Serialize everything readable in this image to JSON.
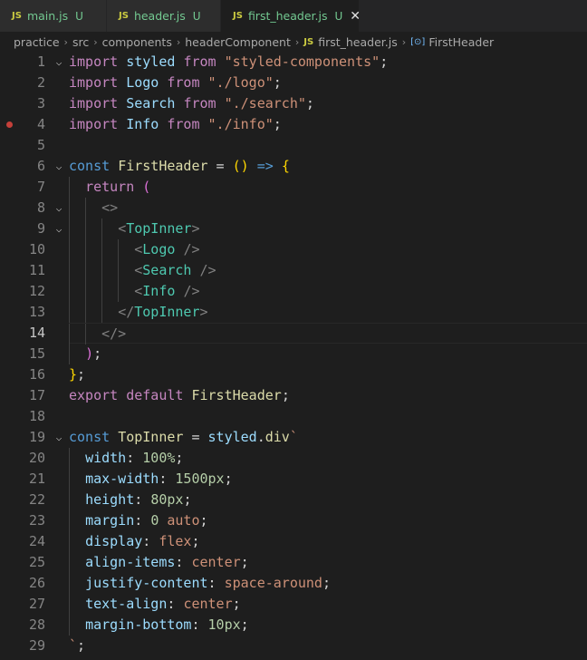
{
  "tabs": [
    {
      "icon": "JS",
      "name": "main.js",
      "status": "U"
    },
    {
      "icon": "JS",
      "name": "header.js",
      "status": "U"
    },
    {
      "icon": "JS",
      "name": "first_header.js",
      "status": "U",
      "close": "✕"
    }
  ],
  "breadcrumb": {
    "items": [
      "practice",
      "src",
      "components",
      "headerComponent"
    ],
    "file_icon": "JS",
    "file": "first_header.js",
    "symbol_icon": "[⊙]",
    "symbol": "FirstHeader",
    "separator": "›"
  },
  "editor": {
    "current_line": 14,
    "breakpoint_line": 4,
    "fold_lines": [
      1,
      6,
      8,
      9,
      19
    ],
    "lines": [
      [
        [
          "kw",
          "import"
        ],
        [
          "pun",
          " "
        ],
        [
          "id",
          "styled"
        ],
        [
          "pun",
          " "
        ],
        [
          "kw",
          "from"
        ],
        [
          "pun",
          " "
        ],
        [
          "str",
          "\"styled-components\""
        ],
        [
          "pun",
          ";"
        ]
      ],
      [
        [
          "kw",
          "import"
        ],
        [
          "pun",
          " "
        ],
        [
          "id",
          "Logo"
        ],
        [
          "pun",
          " "
        ],
        [
          "kw",
          "from"
        ],
        [
          "pun",
          " "
        ],
        [
          "str",
          "\"./logo\""
        ],
        [
          "pun",
          ";"
        ]
      ],
      [
        [
          "kw",
          "import"
        ],
        [
          "pun",
          " "
        ],
        [
          "id",
          "Search"
        ],
        [
          "pun",
          " "
        ],
        [
          "kw",
          "from"
        ],
        [
          "pun",
          " "
        ],
        [
          "str",
          "\"./search\""
        ],
        [
          "pun",
          ";"
        ]
      ],
      [
        [
          "kw",
          "import"
        ],
        [
          "pun",
          " "
        ],
        [
          "id",
          "Info"
        ],
        [
          "pun",
          " "
        ],
        [
          "kw",
          "from"
        ],
        [
          "pun",
          " "
        ],
        [
          "str",
          "\"./info\""
        ],
        [
          "pun",
          ";"
        ]
      ],
      [],
      [
        [
          "kw2",
          "const"
        ],
        [
          "pun",
          " "
        ],
        [
          "fn",
          "FirstHeader"
        ],
        [
          "pun",
          " = "
        ],
        [
          "br1",
          "()"
        ],
        [
          "pun",
          " "
        ],
        [
          "kw2",
          "=>"
        ],
        [
          "pun",
          " "
        ],
        [
          "br1",
          "{"
        ]
      ],
      [
        [
          "pun",
          "  "
        ],
        [
          "kw",
          "return"
        ],
        [
          "pun",
          " "
        ],
        [
          "br2",
          "("
        ]
      ],
      [
        [
          "pun",
          "    "
        ],
        [
          "tagp",
          "<>"
        ]
      ],
      [
        [
          "pun",
          "      "
        ],
        [
          "tagp",
          "<"
        ],
        [
          "tag",
          "TopInner"
        ],
        [
          "tagp",
          ">"
        ]
      ],
      [
        [
          "pun",
          "        "
        ],
        [
          "tagp",
          "<"
        ],
        [
          "tag",
          "Logo"
        ],
        [
          "pun",
          " "
        ],
        [
          "tagp",
          "/>"
        ]
      ],
      [
        [
          "pun",
          "        "
        ],
        [
          "tagp",
          "<"
        ],
        [
          "tag",
          "Search"
        ],
        [
          "pun",
          " "
        ],
        [
          "tagp",
          "/>"
        ]
      ],
      [
        [
          "pun",
          "        "
        ],
        [
          "tagp",
          "<"
        ],
        [
          "tag",
          "Info"
        ],
        [
          "pun",
          " "
        ],
        [
          "tagp",
          "/>"
        ]
      ],
      [
        [
          "pun",
          "      "
        ],
        [
          "tagp",
          "</"
        ],
        [
          "tag",
          "TopInner"
        ],
        [
          "tagp",
          ">"
        ]
      ],
      [
        [
          "pun",
          "    "
        ],
        [
          "tagp",
          "</>"
        ]
      ],
      [
        [
          "pun",
          "  "
        ],
        [
          "br2",
          ")"
        ],
        [
          "pun",
          ";"
        ]
      ],
      [
        [
          "br1",
          "}"
        ],
        [
          "pun",
          ";"
        ]
      ],
      [
        [
          "kw",
          "export"
        ],
        [
          "pun",
          " "
        ],
        [
          "kw",
          "default"
        ],
        [
          "pun",
          " "
        ],
        [
          "fn",
          "FirstHeader"
        ],
        [
          "pun",
          ";"
        ]
      ],
      [],
      [
        [
          "kw2",
          "const"
        ],
        [
          "pun",
          " "
        ],
        [
          "fn",
          "TopInner"
        ],
        [
          "pun",
          " = "
        ],
        [
          "id",
          "styled"
        ],
        [
          "pun",
          "."
        ],
        [
          "fn",
          "div"
        ],
        [
          "str",
          "`"
        ]
      ],
      [
        [
          "pun",
          "  "
        ],
        [
          "prop",
          "width"
        ],
        [
          "pun",
          ": "
        ],
        [
          "num",
          "100%"
        ],
        [
          "pun",
          ";"
        ]
      ],
      [
        [
          "pun",
          "  "
        ],
        [
          "prop",
          "max-width"
        ],
        [
          "pun",
          ": "
        ],
        [
          "num",
          "1500px"
        ],
        [
          "pun",
          ";"
        ]
      ],
      [
        [
          "pun",
          "  "
        ],
        [
          "prop",
          "height"
        ],
        [
          "pun",
          ": "
        ],
        [
          "num",
          "80px"
        ],
        [
          "pun",
          ";"
        ]
      ],
      [
        [
          "pun",
          "  "
        ],
        [
          "prop",
          "margin"
        ],
        [
          "pun",
          ": "
        ],
        [
          "num",
          "0"
        ],
        [
          "pun",
          " "
        ],
        [
          "val",
          "auto"
        ],
        [
          "pun",
          ";"
        ]
      ],
      [
        [
          "pun",
          "  "
        ],
        [
          "prop",
          "display"
        ],
        [
          "pun",
          ": "
        ],
        [
          "val",
          "flex"
        ],
        [
          "pun",
          ";"
        ]
      ],
      [
        [
          "pun",
          "  "
        ],
        [
          "prop",
          "align-items"
        ],
        [
          "pun",
          ": "
        ],
        [
          "val",
          "center"
        ],
        [
          "pun",
          ";"
        ]
      ],
      [
        [
          "pun",
          "  "
        ],
        [
          "prop",
          "justify-content"
        ],
        [
          "pun",
          ": "
        ],
        [
          "val",
          "space-around"
        ],
        [
          "pun",
          ";"
        ]
      ],
      [
        [
          "pun",
          "  "
        ],
        [
          "prop",
          "text-align"
        ],
        [
          "pun",
          ": "
        ],
        [
          "val",
          "center"
        ],
        [
          "pun",
          ";"
        ]
      ],
      [
        [
          "pun",
          "  "
        ],
        [
          "prop",
          "margin-bottom"
        ],
        [
          "pun",
          ": "
        ],
        [
          "num",
          "10px"
        ],
        [
          "pun",
          ";"
        ]
      ],
      [
        [
          "str",
          "`"
        ],
        [
          "pun",
          ";"
        ]
      ]
    ]
  }
}
